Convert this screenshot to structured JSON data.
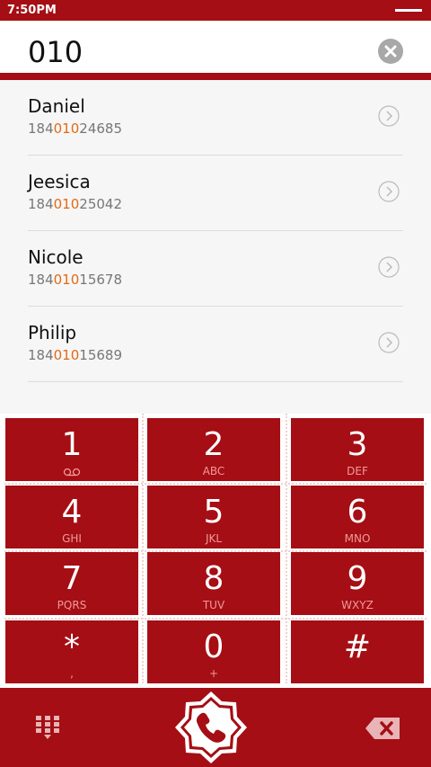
{
  "status_bar": {
    "time": "7:50PM"
  },
  "dial_input": {
    "value": "010"
  },
  "results": [
    {
      "name": "Daniel",
      "prefix": "184",
      "match": "010",
      "suffix": "24685"
    },
    {
      "name": "Jeesica",
      "prefix": "184",
      "match": "010",
      "suffix": "25042"
    },
    {
      "name": "Nicole",
      "prefix": "184",
      "match": "010",
      "suffix": "15678"
    },
    {
      "name": "Philip",
      "prefix": "184",
      "match": "010",
      "suffix": "15689"
    }
  ],
  "keypad": {
    "keys": [
      {
        "digit": "1",
        "letters": ""
      },
      {
        "digit": "2",
        "letters": "ABC"
      },
      {
        "digit": "3",
        "letters": "DEF"
      },
      {
        "digit": "4",
        "letters": "GHI"
      },
      {
        "digit": "5",
        "letters": "JKL"
      },
      {
        "digit": "6",
        "letters": "MNO"
      },
      {
        "digit": "7",
        "letters": "PQRS"
      },
      {
        "digit": "8",
        "letters": "TUV"
      },
      {
        "digit": "9",
        "letters": "WXYZ"
      },
      {
        "digit": "*",
        "letters": ","
      },
      {
        "digit": "0",
        "letters": "+"
      },
      {
        "digit": "#",
        "letters": ""
      }
    ]
  },
  "colors": {
    "brand": "#a50e14",
    "highlight": "#e36a16",
    "list_bg": "#f6f6f6"
  },
  "icons": {
    "clear": "clear-circle-icon",
    "chevron": "chevron-right-icon",
    "voicemail": "voicemail-icon",
    "keypad_toggle": "keypad-grid-icon",
    "call": "phone-icon",
    "backspace": "backspace-icon"
  }
}
